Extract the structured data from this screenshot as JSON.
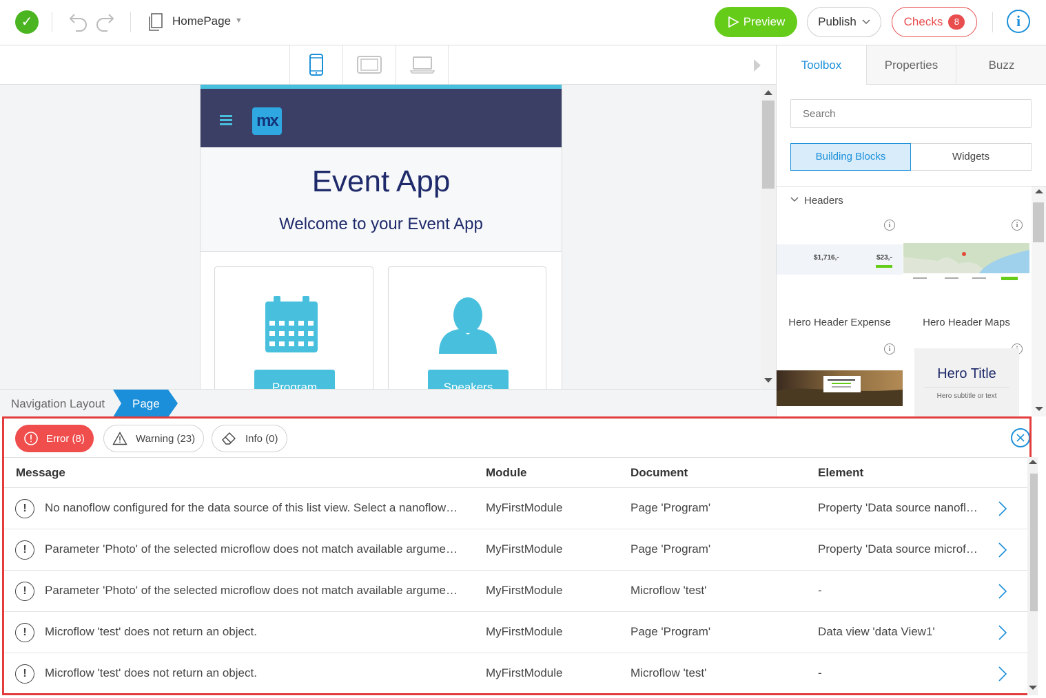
{
  "topbar": {
    "document_name": "HomePage",
    "preview_label": "Preview",
    "publish_label": "Publish",
    "checks_label": "Checks",
    "checks_count": "8",
    "info_glyph": "i",
    "status_glyph": "✓"
  },
  "canvas": {
    "app_title": "Event App",
    "app_subtitle": "Welcome to your Event App",
    "logo_text": "mx",
    "tiles": [
      {
        "label": "Program",
        "icon": "calendar-icon"
      },
      {
        "label": "Speakers",
        "icon": "person-icon"
      }
    ]
  },
  "breadcrumb": {
    "items": [
      "Navigation Layout",
      "Page"
    ]
  },
  "right_panel": {
    "tabs": [
      "Toolbox",
      "Properties",
      "Buzz"
    ],
    "search_placeholder": "Search",
    "segments": [
      "Building Blocks",
      "Widgets"
    ],
    "section_label": "Headers",
    "blocks": [
      {
        "label": "Hero Header Expense",
        "preview_values": [
          "$1,716,-",
          "$23,-"
        ]
      },
      {
        "label": "Hero Header Maps"
      },
      {
        "label": ""
      },
      {
        "label": "",
        "preview_title": "Hero Title",
        "preview_subtitle": "Hero subtitle or text"
      }
    ]
  },
  "checks": {
    "filters": [
      {
        "label": "Error (8)",
        "icon": "error-icon"
      },
      {
        "label": "Warning (23)",
        "icon": "warning-icon"
      },
      {
        "label": "Info (0)",
        "icon": "eraser-icon"
      }
    ],
    "columns": [
      "Message",
      "Module",
      "Document",
      "Element"
    ],
    "rows": [
      {
        "message": "No nanoflow configured for the data source of this list view. Select a nanoflow …",
        "module": "MyFirstModule",
        "document": "Page 'Program'",
        "element": "Property 'Data source nanofl…"
      },
      {
        "message": "Parameter 'Photo' of the selected microflow does not match available argume…",
        "module": "MyFirstModule",
        "document": "Page 'Program'",
        "element": "Property 'Data source microf…"
      },
      {
        "message": "Parameter 'Photo' of the selected microflow does not match available argume…",
        "module": "MyFirstModule",
        "document": "Microflow 'test'",
        "element": "-"
      },
      {
        "message": "Microflow 'test' does not return an object.",
        "module": "MyFirstModule",
        "document": "Page 'Program'",
        "element": "Data view 'data View1'"
      },
      {
        "message": "Microflow 'test' does not return an object.",
        "module": "MyFirstModule",
        "document": "Microflow 'test'",
        "element": "-"
      }
    ],
    "error_glyph": "!"
  },
  "colors": {
    "accent": "#1b8fd9",
    "preview_green": "#66cc1a",
    "error_red": "#e84e4e",
    "header_navy": "#3b3f66",
    "tile_cyan": "#48c0dd"
  }
}
